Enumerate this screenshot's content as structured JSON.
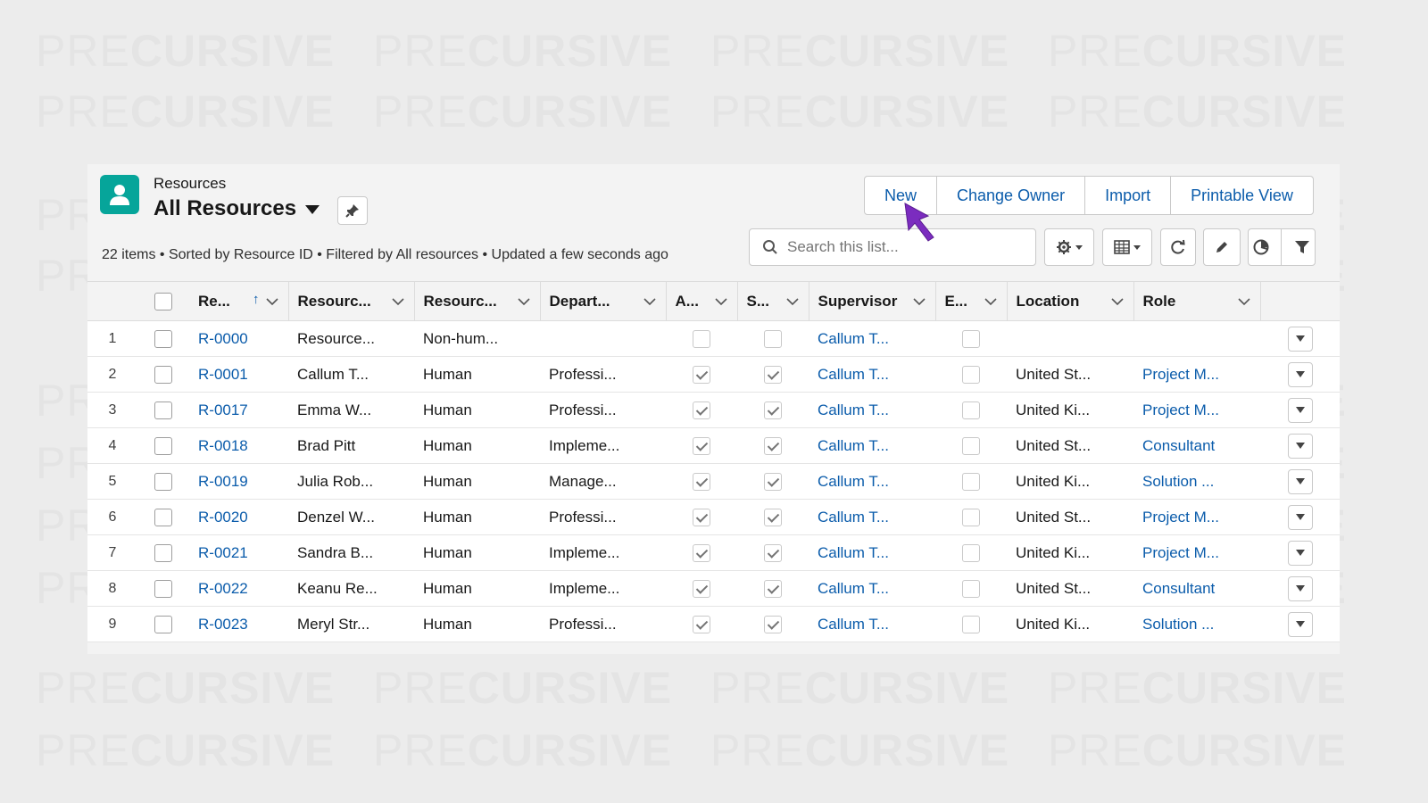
{
  "watermark": {
    "light": "PRE",
    "bold": "CURSIVE"
  },
  "header": {
    "object_label": "Resources",
    "list_view_name": "All Resources",
    "icon": "person-icon",
    "accent_color": "#06a59a"
  },
  "actions": {
    "new": "New",
    "change_owner": "Change Owner",
    "import": "Import",
    "printable_view": "Printable View"
  },
  "meta": {
    "summary": "22 items • Sorted by Resource ID • Filtered by All resources • Updated a few seconds ago"
  },
  "search": {
    "placeholder": "Search this list..."
  },
  "toolbar_icons": [
    "gear-icon",
    "table-icon",
    "refresh-icon",
    "pencil-icon",
    "chart-icon",
    "filter-icon"
  ],
  "table": {
    "columns": [
      "Re...",
      "Resourc...",
      "Resourc...",
      "Depart...",
      "A...",
      "S...",
      "Supervisor",
      "E...",
      "Location",
      "Role"
    ],
    "rows": [
      {
        "n": "1",
        "id": "R-0000",
        "name": "Resource...",
        "type": "Non-hum...",
        "dept": "",
        "a": false,
        "s": false,
        "supervisor": "Callum T...",
        "e": false,
        "location": "",
        "role": ""
      },
      {
        "n": "2",
        "id": "R-0001",
        "name": "Callum T...",
        "type": "Human",
        "dept": "Professi...",
        "a": true,
        "s": true,
        "supervisor": "Callum T...",
        "e": false,
        "location": "United St...",
        "role": "Project M..."
      },
      {
        "n": "3",
        "id": "R-0017",
        "name": "Emma W...",
        "type": "Human",
        "dept": "Professi...",
        "a": true,
        "s": true,
        "supervisor": "Callum T...",
        "e": false,
        "location": "United Ki...",
        "role": "Project M..."
      },
      {
        "n": "4",
        "id": "R-0018",
        "name": "Brad Pitt",
        "type": "Human",
        "dept": "Impleme...",
        "a": true,
        "s": true,
        "supervisor": "Callum T...",
        "e": false,
        "location": "United St...",
        "role": "Consultant"
      },
      {
        "n": "5",
        "id": "R-0019",
        "name": "Julia Rob...",
        "type": "Human",
        "dept": "Manage...",
        "a": true,
        "s": true,
        "supervisor": "Callum T...",
        "e": false,
        "location": "United Ki...",
        "role": "Solution ..."
      },
      {
        "n": "6",
        "id": "R-0020",
        "name": "Denzel W...",
        "type": "Human",
        "dept": "Professi...",
        "a": true,
        "s": true,
        "supervisor": "Callum T...",
        "e": false,
        "location": "United St...",
        "role": "Project M..."
      },
      {
        "n": "7",
        "id": "R-0021",
        "name": "Sandra B...",
        "type": "Human",
        "dept": "Impleme...",
        "a": true,
        "s": true,
        "supervisor": "Callum T...",
        "e": false,
        "location": "United Ki...",
        "role": "Project M..."
      },
      {
        "n": "8",
        "id": "R-0022",
        "name": "Keanu Re...",
        "type": "Human",
        "dept": "Impleme...",
        "a": true,
        "s": true,
        "supervisor": "Callum T...",
        "e": false,
        "location": "United St...",
        "role": "Consultant"
      },
      {
        "n": "9",
        "id": "R-0023",
        "name": "Meryl Str...",
        "type": "Human",
        "dept": "Professi...",
        "a": true,
        "s": true,
        "supervisor": "Callum T...",
        "e": false,
        "location": "United Ki...",
        "role": "Solution ..."
      }
    ]
  },
  "colors": {
    "link": "#0b5cab",
    "cursor": "#7b2cbf"
  }
}
